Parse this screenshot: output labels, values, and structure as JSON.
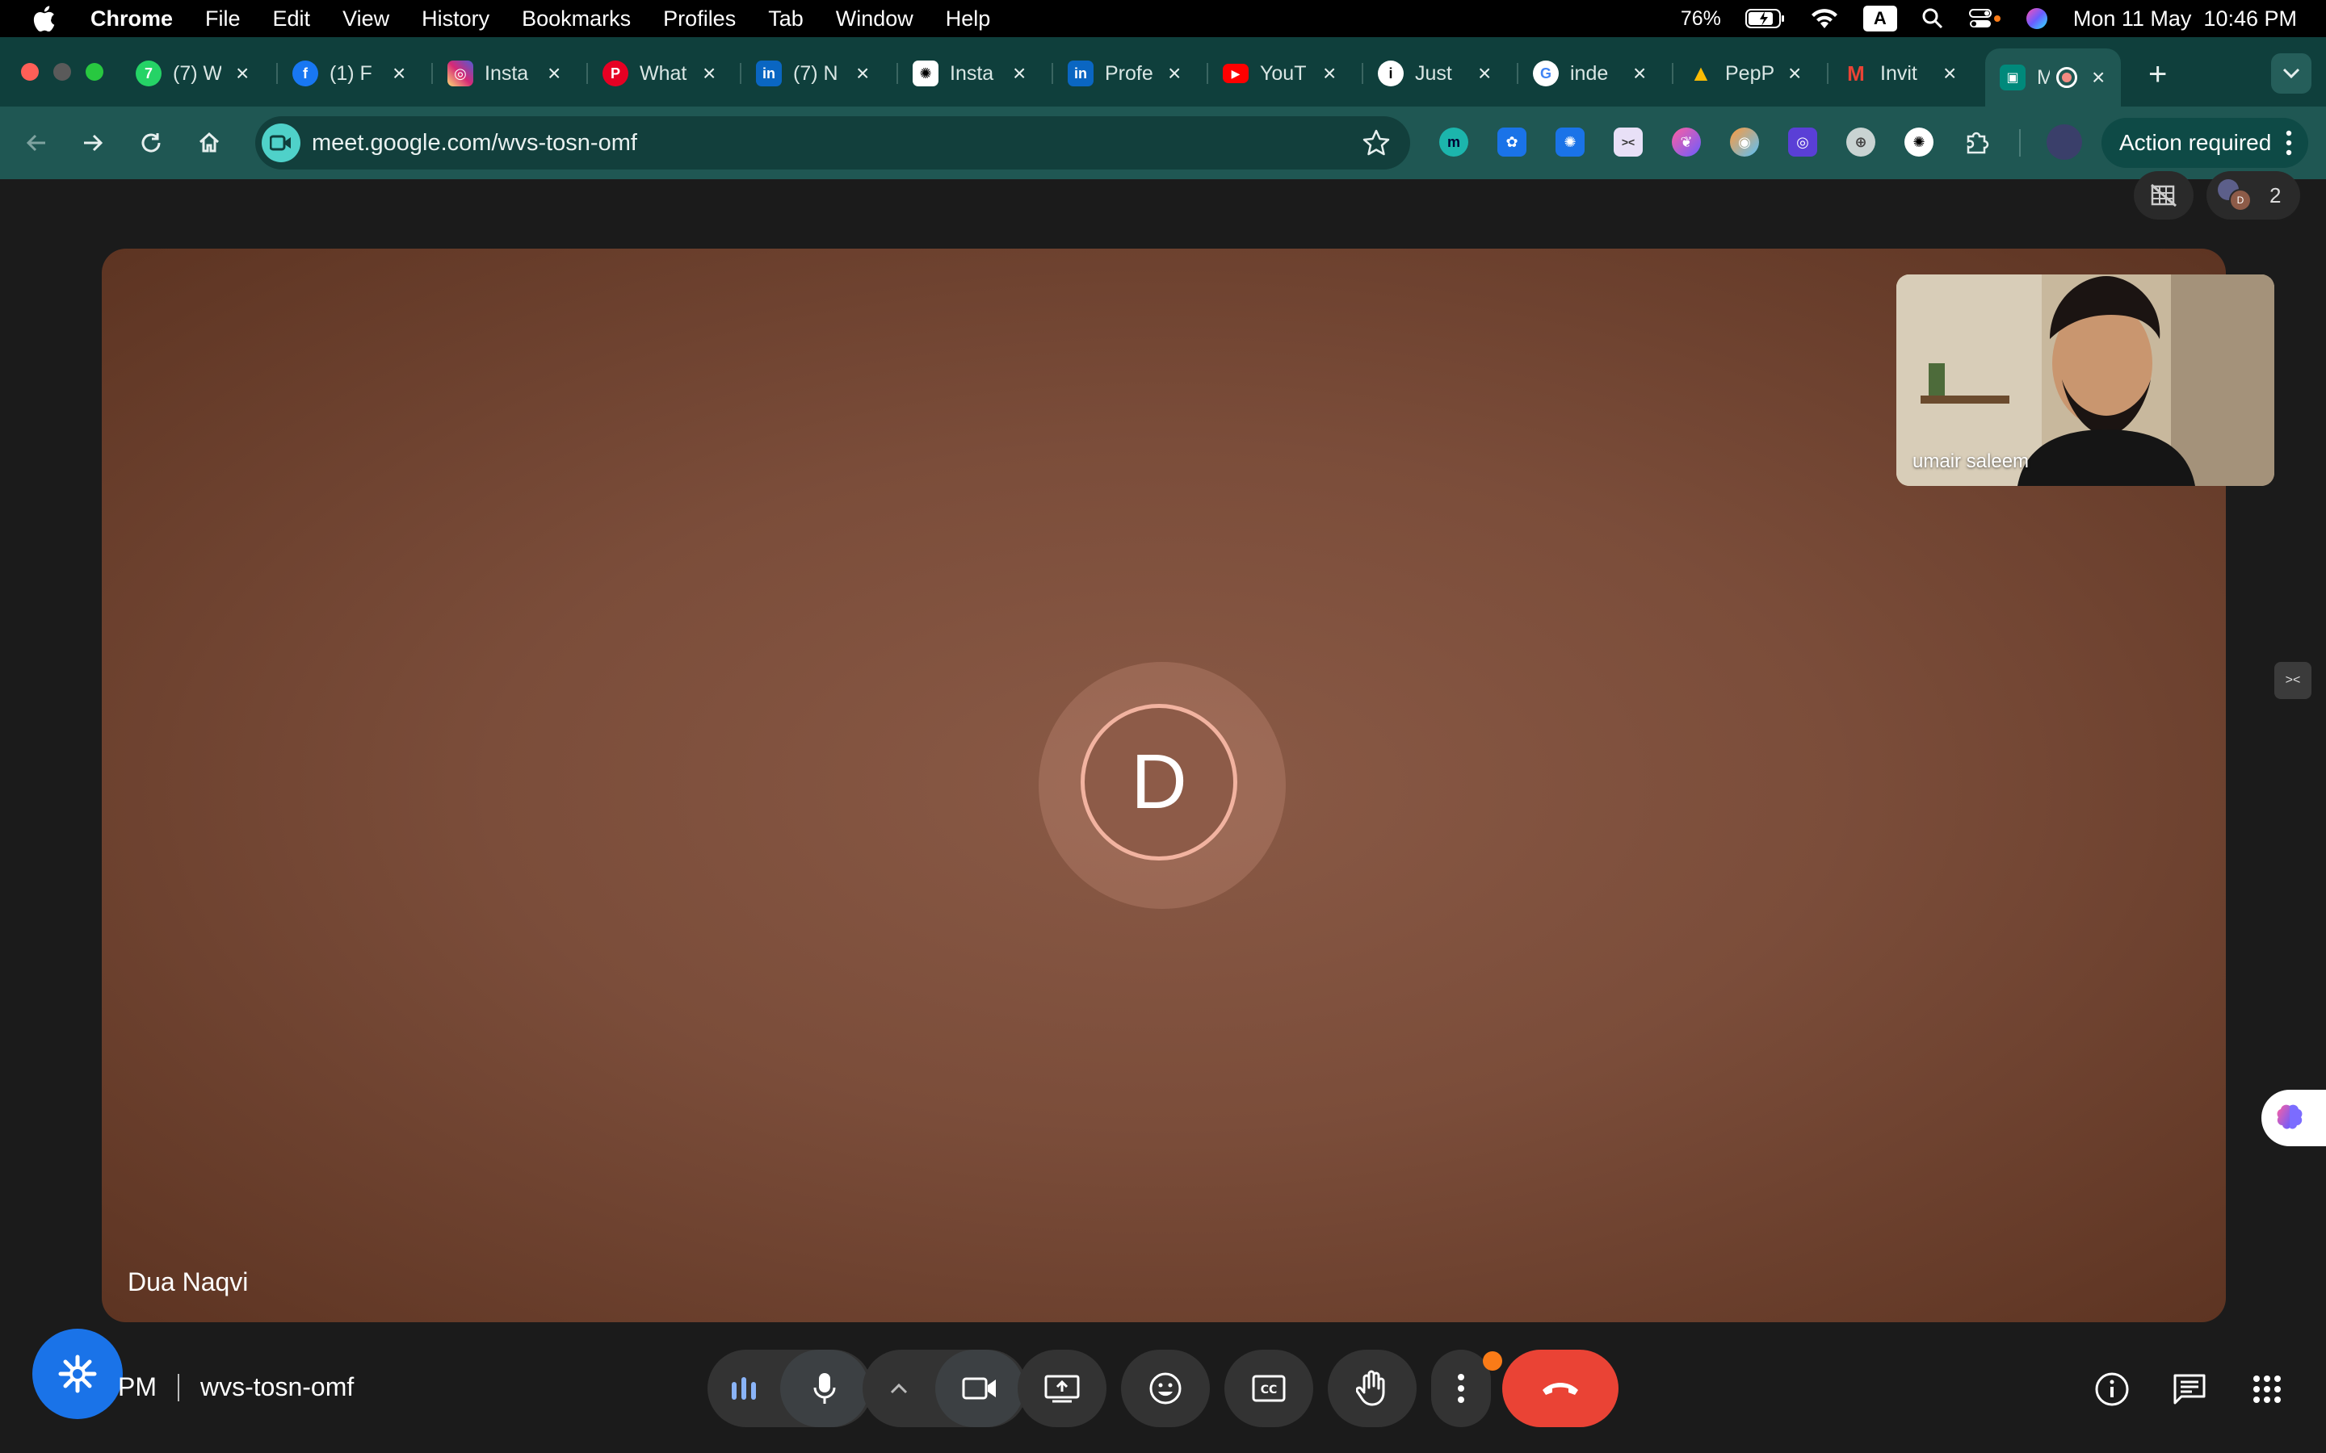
{
  "menubar": {
    "app": "Chrome",
    "items": [
      "File",
      "Edit",
      "View",
      "History",
      "Bookmarks",
      "Profiles",
      "Tab",
      "Window",
      "Help"
    ],
    "battery": "76%",
    "input_source": "A",
    "datetime": "Mon 11 May  10:46 PM"
  },
  "tabs": [
    {
      "label": "(7) W",
      "fav": "7",
      "color": "#25d366"
    },
    {
      "label": "(1) F",
      "fav": "f",
      "color": "#1877f2"
    },
    {
      "label": "Insta",
      "fav": "◎",
      "color": "#e1306c"
    },
    {
      "label": "What",
      "fav": "P",
      "color": "#e60023"
    },
    {
      "label": "(7) N",
      "fav": "in",
      "color": "#0a66c2"
    },
    {
      "label": "Insta",
      "fav": "✺",
      "color": "#ffffff"
    },
    {
      "label": "Profe",
      "fav": "in",
      "color": "#0a66c2"
    },
    {
      "label": "YouT",
      "fav": "▶",
      "color": "#ff0000"
    },
    {
      "label": "Just",
      "fav": "i",
      "color": "#ffffff"
    },
    {
      "label": "inde",
      "fav": "G",
      "color": "#ffffff"
    },
    {
      "label": "PepP",
      "fav": "▲",
      "color": "#34a853"
    },
    {
      "label": "Invit",
      "fav": "M",
      "color": "#ffffff"
    },
    {
      "label": "M",
      "fav": "▣",
      "color": "#00897b"
    }
  ],
  "toolbar": {
    "url": "meet.google.com/wvs-tosn-omf",
    "ext_m": "m",
    "action_label": "Action required"
  },
  "meet": {
    "participant_count": "2",
    "main_initial": "D",
    "main_name": "Dua Naqvi",
    "self_name": "umair saleem",
    "time_suffix": "PM",
    "meeting_code": "wvs-tosn-omf"
  },
  "colors": {
    "accent_blue": "#1a73e8",
    "end_call_red": "#ea4335",
    "tab_strip": "#0f3f3c",
    "toolbar": "#1f5753"
  }
}
